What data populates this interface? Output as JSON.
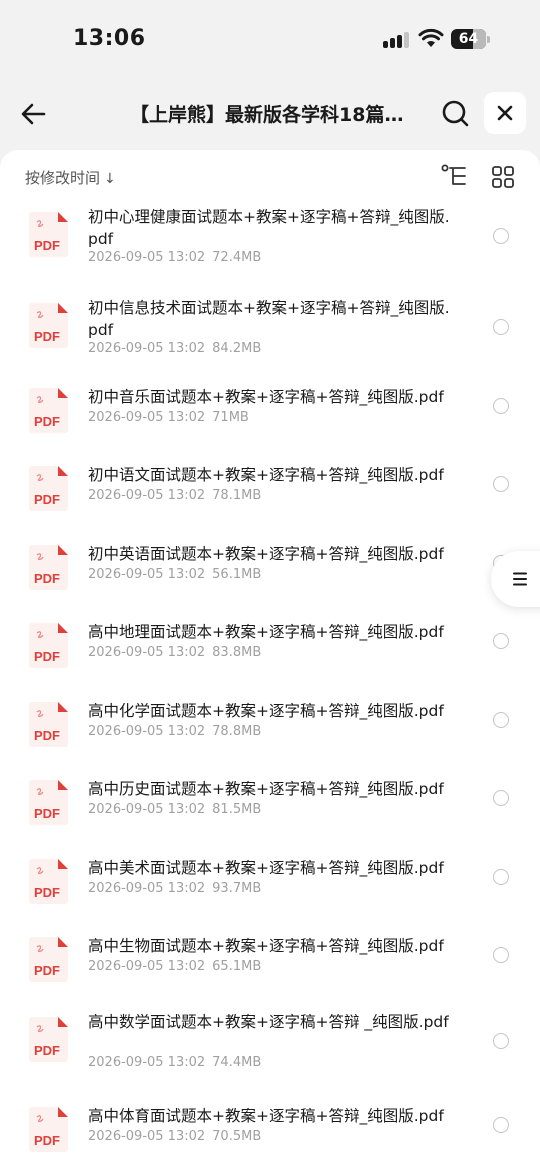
{
  "status_bar": {
    "time": "13:06",
    "battery": "64"
  },
  "nav": {
    "title": "【上岸熊】最新版各学科18篇…",
    "back_icon": "arrow-left-icon",
    "search_icon": "search-icon",
    "close_icon": "close-icon"
  },
  "toolbar": {
    "sort_label": "按修改时间",
    "sort_arrow": "↓",
    "tree_icon": "folder-tree-icon",
    "grid_icon": "grid-view-icon"
  },
  "files": [
    {
      "name": "初中心理健康面试题本+教案+逐字稿+答辩_纯图版.pdf",
      "date": "2026-09-05 13:02",
      "size": "72.4MB",
      "lines": 2
    },
    {
      "name": "初中信息技术面试题本+教案+逐字稿+答辩_纯图版.pdf",
      "date": "2026-09-05 13:02",
      "size": "84.2MB",
      "lines": 2
    },
    {
      "name": "初中音乐面试题本+教案+逐字稿+答辩_纯图版.pdf",
      "date": "2026-09-05 13:02",
      "size": "71MB",
      "lines": 1
    },
    {
      "name": "初中语文面试题本+教案+逐字稿+答辩_纯图版.pdf",
      "date": "2026-09-05 13:02",
      "size": "78.1MB",
      "lines": 1
    },
    {
      "name": "初中英语面试题本+教案+逐字稿+答辩_纯图版.pdf",
      "date": "2026-09-05 13:02",
      "size": "56.1MB",
      "lines": 1
    },
    {
      "name": "高中地理面试题本+教案+逐字稿+答辩_纯图版.pdf",
      "date": "2026-09-05 13:02",
      "size": "83.8MB",
      "lines": 1
    },
    {
      "name": "高中化学面试题本+教案+逐字稿+答辩_纯图版.pdf",
      "date": "2026-09-05 13:02",
      "size": "78.8MB",
      "lines": 1
    },
    {
      "name": "高中历史面试题本+教案+逐字稿+答辩_纯图版.pdf",
      "date": "2026-09-05 13:02",
      "size": "81.5MB",
      "lines": 1
    },
    {
      "name": "高中美术面试题本+教案+逐字稿+答辩_纯图版.pdf",
      "date": "2026-09-05 13:02",
      "size": "93.7MB",
      "lines": 1
    },
    {
      "name": "高中生物面试题本+教案+逐字稿+答辩_纯图版.pdf",
      "date": "2026-09-05 13:02",
      "size": "65.1MB",
      "lines": 1
    },
    {
      "name": "高中数学面试题本+教案+逐字稿+答辩 _纯图版.pdf",
      "date": "2026-09-05 13:02",
      "size": "74.4MB",
      "lines": 2
    },
    {
      "name": "高中体育面试题本+教案+逐字稿+答辩_纯图版.pdf",
      "date": "2026-09-05 13:02",
      "size": "70.5MB",
      "lines": 1
    }
  ],
  "pdf_badge": "PDF",
  "colors": {
    "pdf_red": "#e0403a",
    "pdf_bg": "#fdf1f0",
    "meta_gray": "#a0a0a0",
    "page_bg": "#f2f2f2"
  },
  "side_handle_icon": "menu-lines-icon"
}
